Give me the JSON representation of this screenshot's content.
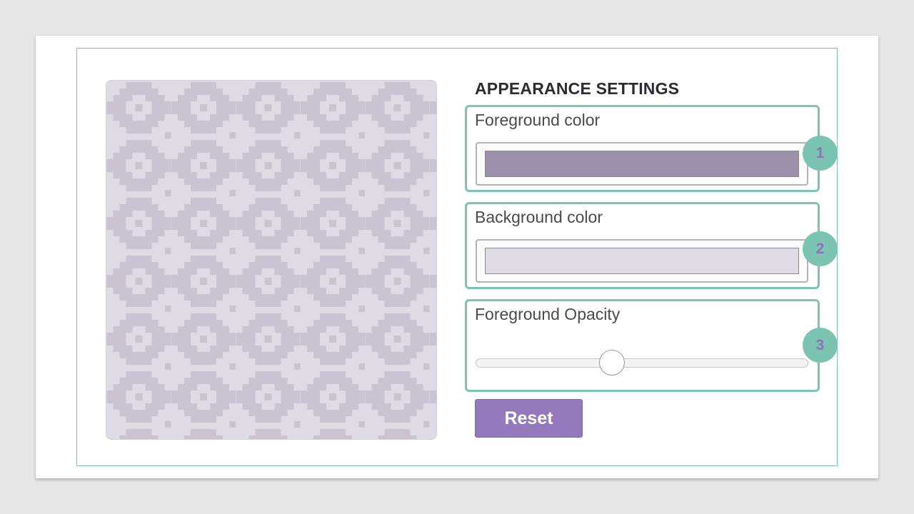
{
  "settings": {
    "title": "APPEARANCE SETTINGS",
    "foreground": {
      "label": "Foreground color",
      "value": "#9c91ab",
      "badge": "1"
    },
    "background": {
      "label": "Background color",
      "value": "#dedbe4",
      "badge": "2"
    },
    "opacity": {
      "label": "Foreground Opacity",
      "value": 0.41,
      "badge": "3"
    },
    "reset_label": "Reset"
  },
  "colors": {
    "accent": "#7cc4b2",
    "button": "#9479bd",
    "pattern_motif": "#c9c3d2"
  }
}
